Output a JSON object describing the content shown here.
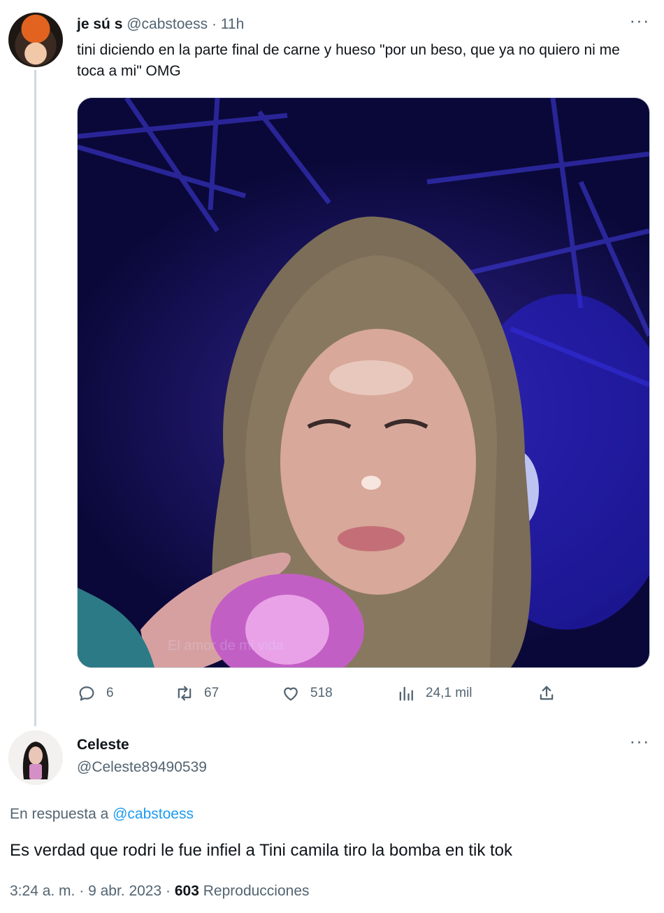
{
  "tweet1": {
    "display_name": "je sú s",
    "handle": "@cabstoess",
    "separator": "·",
    "time": "11h",
    "more": "···",
    "text": "tini diciendo en la parte final de carne y hueso \"por un beso, que ya no quiero ni me toca a mi\" OMG",
    "media": {
      "watermark": "El amor de mi vida"
    },
    "actions": {
      "replies": "6",
      "retweets": "67",
      "likes": "518",
      "views": "24,1 mil"
    }
  },
  "tweet2": {
    "display_name": "Celeste",
    "handle": "@Celeste89490539",
    "more": "···",
    "replying_prefix": "En respuesta a ",
    "replying_to": "@cabstoess",
    "text": "Es verdad que rodri le fue infiel a Tini camila tiro la bomba en tik tok",
    "time": "3:24 a. m.",
    "separator": "·",
    "date": "9 abr. 2023",
    "separator2": "·",
    "views_count": "603",
    "views_label": "Reproducciones"
  },
  "colors": {
    "text_primary": "#0f1419",
    "text_secondary": "#536471",
    "link": "#1d9bf0",
    "thread_line": "#cfd9de"
  }
}
